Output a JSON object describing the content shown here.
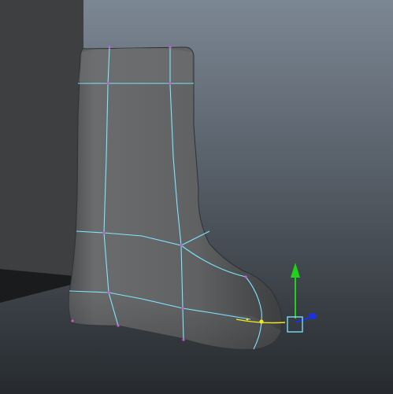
{
  "viewport": {
    "background_top": "#7c8794",
    "background_bottom": "#262a2e",
    "wall_color": "#3d3f41",
    "mesh_fill": "#5c5e60",
    "wireframe_color": "#7fe7ff",
    "vertex_color": "#c85bd8",
    "selection_color": "#f2ea1e"
  },
  "manipulator": {
    "type": "move-tool",
    "y_axis_color": "#22d11a",
    "z_axis_color": "#1a33e0",
    "pivot_color": "#7fe7ff"
  },
  "model": {
    "name": "boot-mesh"
  }
}
